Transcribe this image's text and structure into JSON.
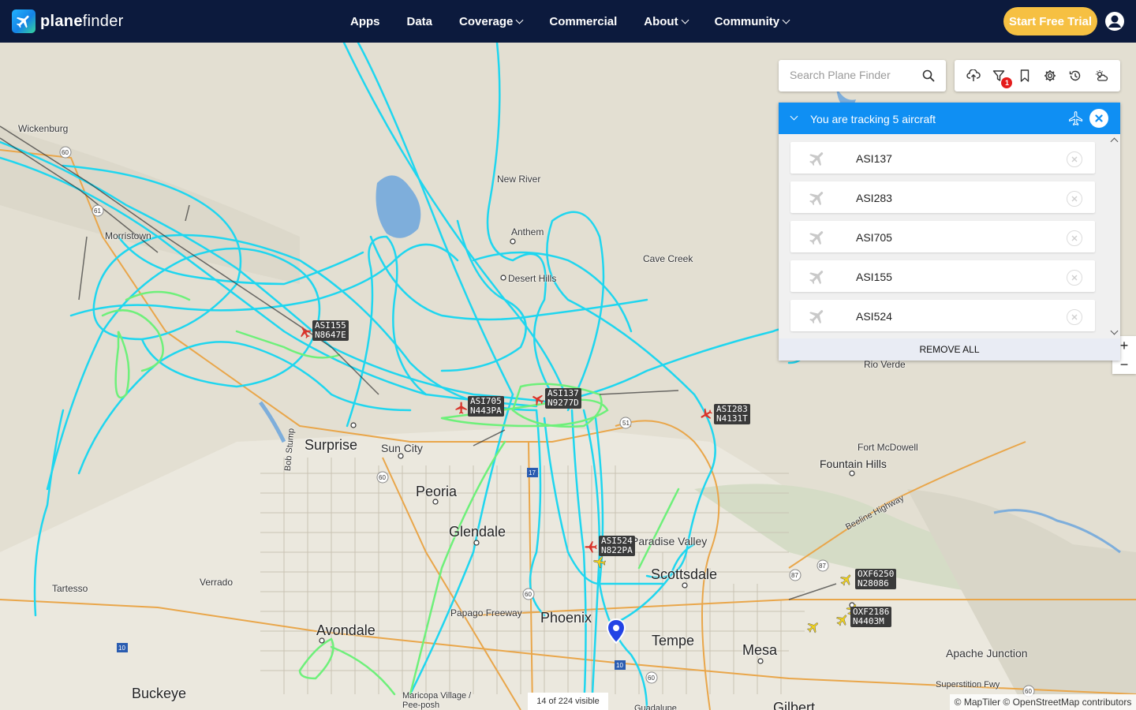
{
  "brand": {
    "name_bold": "plane",
    "name_rest": "finder"
  },
  "nav": {
    "items": [
      {
        "label": "Apps",
        "dropdown": false
      },
      {
        "label": "Data",
        "dropdown": false
      },
      {
        "label": "Coverage",
        "dropdown": true
      },
      {
        "label": "Commercial",
        "dropdown": false
      },
      {
        "label": "About",
        "dropdown": true
      },
      {
        "label": "Community",
        "dropdown": true
      }
    ],
    "cta": "Start Free Trial"
  },
  "search": {
    "placeholder": "Search Plane Finder",
    "value": ""
  },
  "toolbar": {
    "icons": [
      "cloud-upload-icon",
      "filter-icon",
      "bookmark-icon",
      "settings-icon",
      "history-icon",
      "weather-icon"
    ],
    "filter_badge": "1"
  },
  "tracking": {
    "title": "You are tracking 5 aircraft",
    "items": [
      "ASI137",
      "ASI283",
      "ASI705",
      "ASI155",
      "ASI524"
    ],
    "remove_all": "REMOVE ALL"
  },
  "zoom": {
    "in": "+",
    "out": "−"
  },
  "aircraft": [
    {
      "flight": "ASI155",
      "reg": "N8647E"
    },
    {
      "flight": "ASI705",
      "reg": "N443PA"
    },
    {
      "flight": "ASI137",
      "reg": "N9277D"
    },
    {
      "flight": "ASI283",
      "reg": "N4131T"
    },
    {
      "flight": "ASI524",
      "reg": "N822PA"
    },
    {
      "flight": "OXF6250",
      "reg": "N28086"
    },
    {
      "flight": "OXF2186",
      "reg": "N4403M"
    }
  ],
  "places": {
    "wickenburg": "Wickenburg",
    "new_river": "New River",
    "anthem": "Anthem",
    "cave_creek": "Cave Creek",
    "desert_hills": "Desert Hills",
    "morristown": "Morristown",
    "rio_verde": "Rio Verde",
    "surprise": "Surprise",
    "sun_city": "Sun City",
    "peoria": "Peoria",
    "glendale": "Glendale",
    "fort_mcdowell": "Fort McDowell",
    "fountain_hills": "Fountain Hills",
    "paradise_valley": "Paradise Valley",
    "scottsdale": "Scottsdale",
    "phoenix": "Phoenix",
    "tempe": "Tempe",
    "mesa": "Mesa",
    "apache_junction": "Apache Junction",
    "tartesso": "Tartesso",
    "verrado": "Verrado",
    "avondale": "Avondale",
    "buckeye": "Buckeye",
    "papago": "Papago Freeway",
    "bob_stump": "Bob Stump",
    "beeline": "Beeline Highway",
    "superstition": "Superstition Fwy",
    "maricopa": "Maricopa Village / Pee-posh",
    "gilbert": "Gilbert",
    "guadalupe": "Guadalupe"
  },
  "map_footer": {
    "visible": "14 of 224 visible",
    "attribution": "© MapTiler © OpenStreetMap contributors"
  },
  "colors": {
    "nav_bg": "#0c1a3d",
    "cta": "#f6c042",
    "panel_header": "#0f8ff3",
    "track_cyan": "#1fd6ef",
    "track_green": "#6ef07a",
    "tracked_plane": "#d9342b",
    "other_plane": "#f1d21d"
  }
}
